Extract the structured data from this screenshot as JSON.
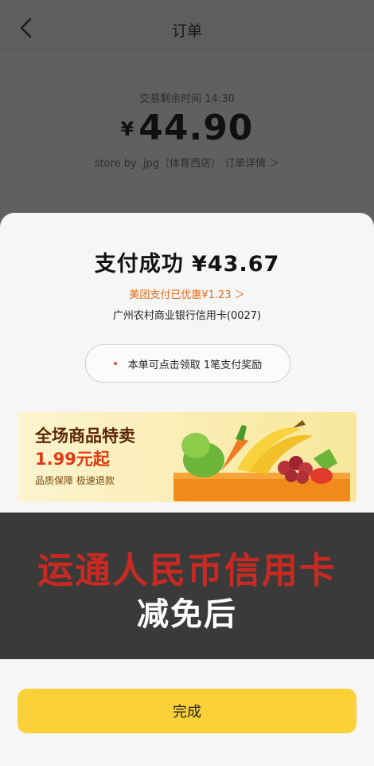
{
  "header": {
    "title": "订单",
    "back_icon": "chevron-left-icon"
  },
  "order": {
    "remaining_label": "交易剩余时间 14:30",
    "currency": "¥",
    "amount": "44.90",
    "store_line": "store by .jpg（体育西店） 订单详情 ＞"
  },
  "result": {
    "title": "支付成功 ¥43.67",
    "discount": "美团支付已优惠¥1.23 ＞",
    "card": "广州农村商业银行信用卡(0027)",
    "reward": "本单可点击领取 1笔支付奖励"
  },
  "banner": {
    "title": "全场商品特卖",
    "price": "1.99元起",
    "sub": "品质保障 极速退款"
  },
  "overlay": {
    "line1": "运通人民币信用卡",
    "line2": "减免后"
  },
  "actions": {
    "done": "完成"
  },
  "colors": {
    "accent": "#fbd13a",
    "discount": "#e06a1b",
    "overlay_red": "#c82a22"
  }
}
